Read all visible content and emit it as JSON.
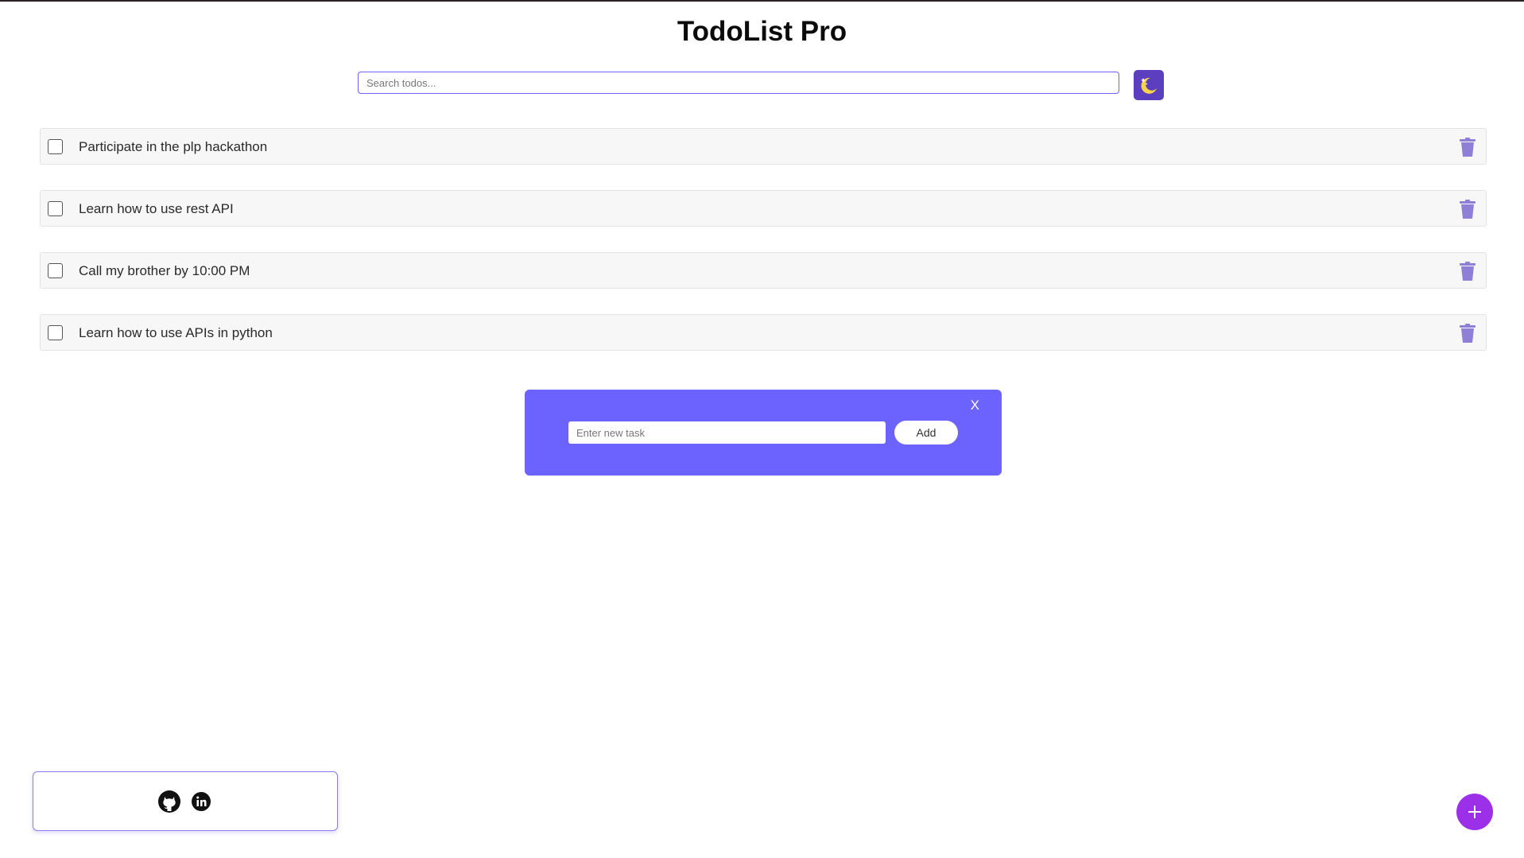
{
  "app": {
    "title": "TodoList Pro"
  },
  "search": {
    "placeholder": "Search todos...",
    "value": ""
  },
  "theme_toggle": {
    "icon": "moon-stars-icon"
  },
  "todos": [
    {
      "text": "Participate in the plp hackathon",
      "completed": false
    },
    {
      "text": "Learn how to use rest API",
      "completed": false
    },
    {
      "text": "Call my brother by 10:00 PM",
      "completed": false
    },
    {
      "text": "Learn how to use APIs in python",
      "completed": false
    }
  ],
  "add_modal": {
    "close_label": "X",
    "input_placeholder": "Enter new task",
    "input_value": "",
    "add_label": "Add"
  },
  "social": {
    "links": [
      "github-icon",
      "linkedin-icon"
    ]
  },
  "fab": {
    "icon": "plus-icon"
  },
  "colors": {
    "accent": "#6c63ff",
    "theme_button": "#5b3fbf",
    "delete_icon": "#8f7fd6",
    "fab": "#9b30e8"
  }
}
